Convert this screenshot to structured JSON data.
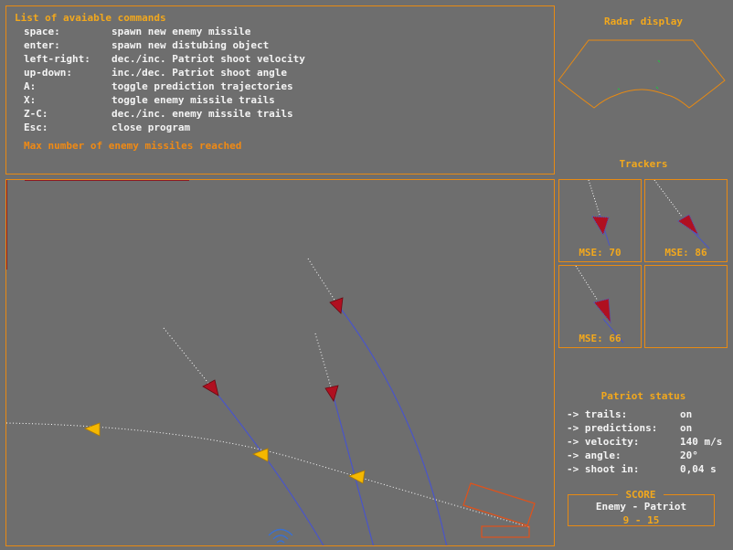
{
  "commands": {
    "title": "List of avaiable commands",
    "items": [
      {
        "key": "space:",
        "desc": "spawn new enemy missile"
      },
      {
        "key": "enter:",
        "desc": "spawn new distubing object"
      },
      {
        "key": "left-right:",
        "desc": "dec./inc. Patriot shoot velocity"
      },
      {
        "key": "up-down:",
        "desc": "inc./dec. Patriot shoot angle"
      },
      {
        "key": "A:",
        "desc": "toggle prediction trajectories"
      },
      {
        "key": "X:",
        "desc": "toggle enemy missile trails"
      },
      {
        "key": "Z-C:",
        "desc": "dec./inc. enemy missile trails"
      },
      {
        "key": "Esc:",
        "desc": "close program"
      }
    ],
    "warning": "Max number of enemy missiles reached"
  },
  "radar": {
    "title": "Radar display",
    "blip_count": 3
  },
  "trackers": {
    "title": "Trackers",
    "items": [
      {
        "mse": "MSE: 70"
      },
      {
        "mse": "MSE: 86"
      },
      {
        "mse": "MSE: 66"
      },
      {
        "mse": ""
      }
    ]
  },
  "patriot_status": {
    "title": "Patriot status",
    "rows": [
      {
        "label": "-> trails:",
        "value": "on"
      },
      {
        "label": "-> predictions:",
        "value": "on"
      },
      {
        "label": "-> velocity:",
        "value": "140 m/s"
      },
      {
        "label": "-> angle:",
        "value": "20°"
      },
      {
        "label": "-> shoot in:",
        "value": "0,04 s"
      }
    ]
  },
  "score": {
    "label": "SCORE",
    "header": "Enemy - Patriot",
    "value": "9 - 15"
  },
  "colors": {
    "accent": "#e88a12",
    "text_orange": "#f2a81d",
    "background": "#6e6e6e",
    "enemy_missile": "#b01020",
    "patriot_missile": "#f5b800",
    "prediction_line": "#4a55c8",
    "radar_blip": "#22c040"
  }
}
